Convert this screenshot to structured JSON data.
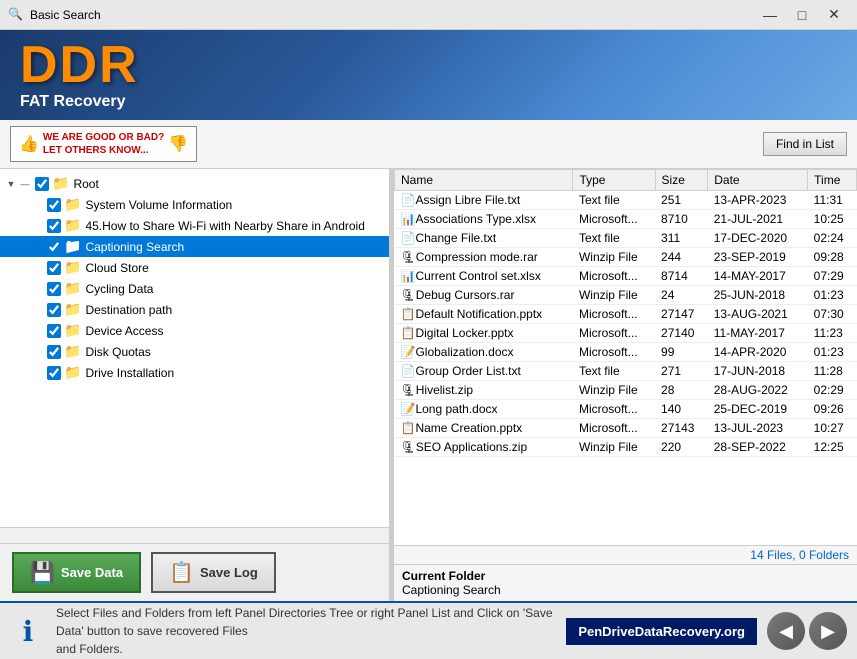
{
  "titleBar": {
    "title": "Basic Search",
    "icon": "🔍",
    "minimizeLabel": "—",
    "maximizeLabel": "□",
    "closeLabel": "✕"
  },
  "header": {
    "ddr": "DDR",
    "subtitle": "FAT Recovery"
  },
  "toolbar": {
    "ratingLine1": "WE ARE GOOD OR BAD?",
    "ratingLine2": "LET OTHERS KNOW...",
    "findBtn": "Find in List"
  },
  "tree": {
    "root": {
      "label": "Root",
      "items": [
        {
          "label": "System Volume Information",
          "indent": 1,
          "checked": true,
          "selected": false
        },
        {
          "label": "45.How to Share Wi-Fi with Nearby Share in Android",
          "indent": 1,
          "checked": true,
          "selected": false
        },
        {
          "label": "Captioning Search",
          "indent": 1,
          "checked": true,
          "selected": true
        },
        {
          "label": "Cloud Store",
          "indent": 1,
          "checked": true,
          "selected": false
        },
        {
          "label": "Cycling Data",
          "indent": 1,
          "checked": true,
          "selected": false
        },
        {
          "label": "Destination path",
          "indent": 1,
          "checked": true,
          "selected": false
        },
        {
          "label": "Device Access",
          "indent": 1,
          "checked": true,
          "selected": false
        },
        {
          "label": "Disk Quotas",
          "indent": 1,
          "checked": true,
          "selected": false
        },
        {
          "label": "Drive Installation",
          "indent": 1,
          "checked": true,
          "selected": false
        }
      ]
    }
  },
  "fileList": {
    "columns": [
      "Name",
      "Type",
      "Size",
      "Date",
      "Time"
    ],
    "files": [
      {
        "name": "Assign Libre File.txt",
        "type": "Text file",
        "size": "251",
        "date": "13-APR-2023",
        "time": "11:31",
        "icon": "📄"
      },
      {
        "name": "Associations Type.xlsx",
        "type": "Microsoft...",
        "size": "8710",
        "date": "21-JUL-2021",
        "time": "10:25",
        "icon": "📊"
      },
      {
        "name": "Change File.txt",
        "type": "Text file",
        "size": "311",
        "date": "17-DEC-2020",
        "time": "02:24",
        "icon": "📄"
      },
      {
        "name": "Compression mode.rar",
        "type": "Winzip File",
        "size": "244",
        "date": "23-SEP-2019",
        "time": "09:28",
        "icon": "🗜"
      },
      {
        "name": "Current Control set.xlsx",
        "type": "Microsoft...",
        "size": "8714",
        "date": "14-MAY-2017",
        "time": "07:29",
        "icon": "📊"
      },
      {
        "name": "Debug Cursors.rar",
        "type": "Winzip File",
        "size": "24",
        "date": "25-JUN-2018",
        "time": "01:23",
        "icon": "🗜"
      },
      {
        "name": "Default Notification.pptx",
        "type": "Microsoft...",
        "size": "27147",
        "date": "13-AUG-2021",
        "time": "07:30",
        "icon": "📋"
      },
      {
        "name": "Digital Locker.pptx",
        "type": "Microsoft...",
        "size": "27140",
        "date": "11-MAY-2017",
        "time": "11:23",
        "icon": "📋"
      },
      {
        "name": "Globalization.docx",
        "type": "Microsoft...",
        "size": "99",
        "date": "14-APR-2020",
        "time": "01:23",
        "icon": "📝"
      },
      {
        "name": "Group Order List.txt",
        "type": "Text file",
        "size": "271",
        "date": "17-JUN-2018",
        "time": "11:28",
        "icon": "📄"
      },
      {
        "name": "Hivelist.zip",
        "type": "Winzip File",
        "size": "28",
        "date": "28-AUG-2022",
        "time": "02:29",
        "icon": "🗜"
      },
      {
        "name": "Long path.docx",
        "type": "Microsoft...",
        "size": "140",
        "date": "25-DEC-2019",
        "time": "09:26",
        "icon": "📝"
      },
      {
        "name": "Name Creation.pptx",
        "type": "Microsoft...",
        "size": "27143",
        "date": "13-JUL-2023",
        "time": "10:27",
        "icon": "📋"
      },
      {
        "name": "SEO Applications.zip",
        "type": "Winzip File",
        "size": "220",
        "date": "28-SEP-2022",
        "time": "12:25",
        "icon": "🗜"
      }
    ],
    "fileCount": "14 Files, 0 Folders"
  },
  "currentFolder": {
    "label": "Current Folder",
    "name": "Captioning Search"
  },
  "actions": {
    "saveData": "Save Data",
    "saveLog": "Save Log"
  },
  "statusBar": {
    "text1": "Select Files and Folders from left Panel Directories Tree or right Panel List and Click on 'Save Data' button to save recovered Files",
    "text2": "and Folders.",
    "website": "PenDriveDataRecovery.org"
  }
}
